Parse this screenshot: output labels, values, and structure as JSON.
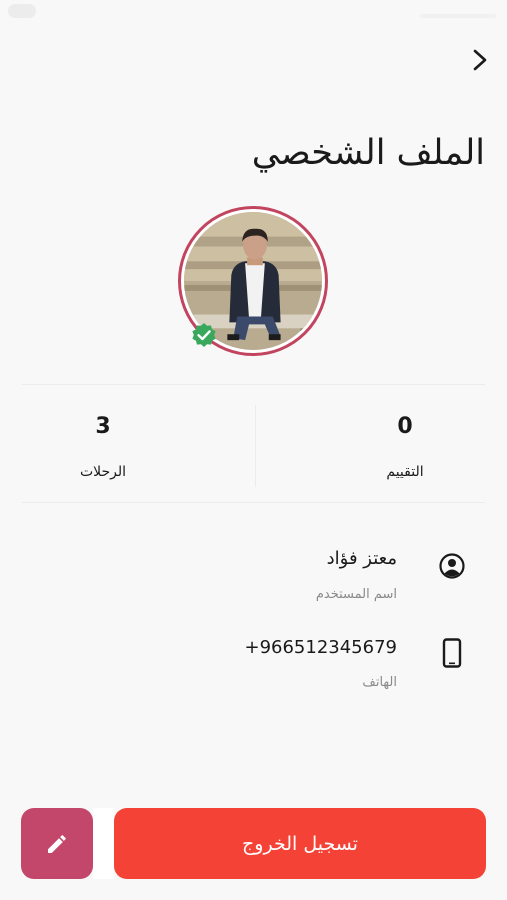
{
  "header": {
    "title": "الملف الشخصي",
    "back_icon": "chevron-right-icon"
  },
  "profile": {
    "avatar": "user-photo",
    "verified_icon": "verified-check-icon",
    "verified_color": "#3aa85c",
    "ring_color": "#c2455f"
  },
  "stats": [
    {
      "value": "0",
      "label": "التقييم"
    },
    {
      "value": "3",
      "label": "الرحلات"
    }
  ],
  "info": {
    "username": {
      "value": "معتز فؤاد",
      "label": "اسم المستخدم",
      "icon": "user-circle-icon"
    },
    "phone": {
      "value": "966512345679+",
      "label": "الهاتف",
      "icon": "smartphone-icon"
    }
  },
  "actions": {
    "logout_label": "تسجيل الخروج",
    "logout_color": "#f44336",
    "edit_icon": "pencil-icon",
    "edit_color": "#c2476a"
  }
}
